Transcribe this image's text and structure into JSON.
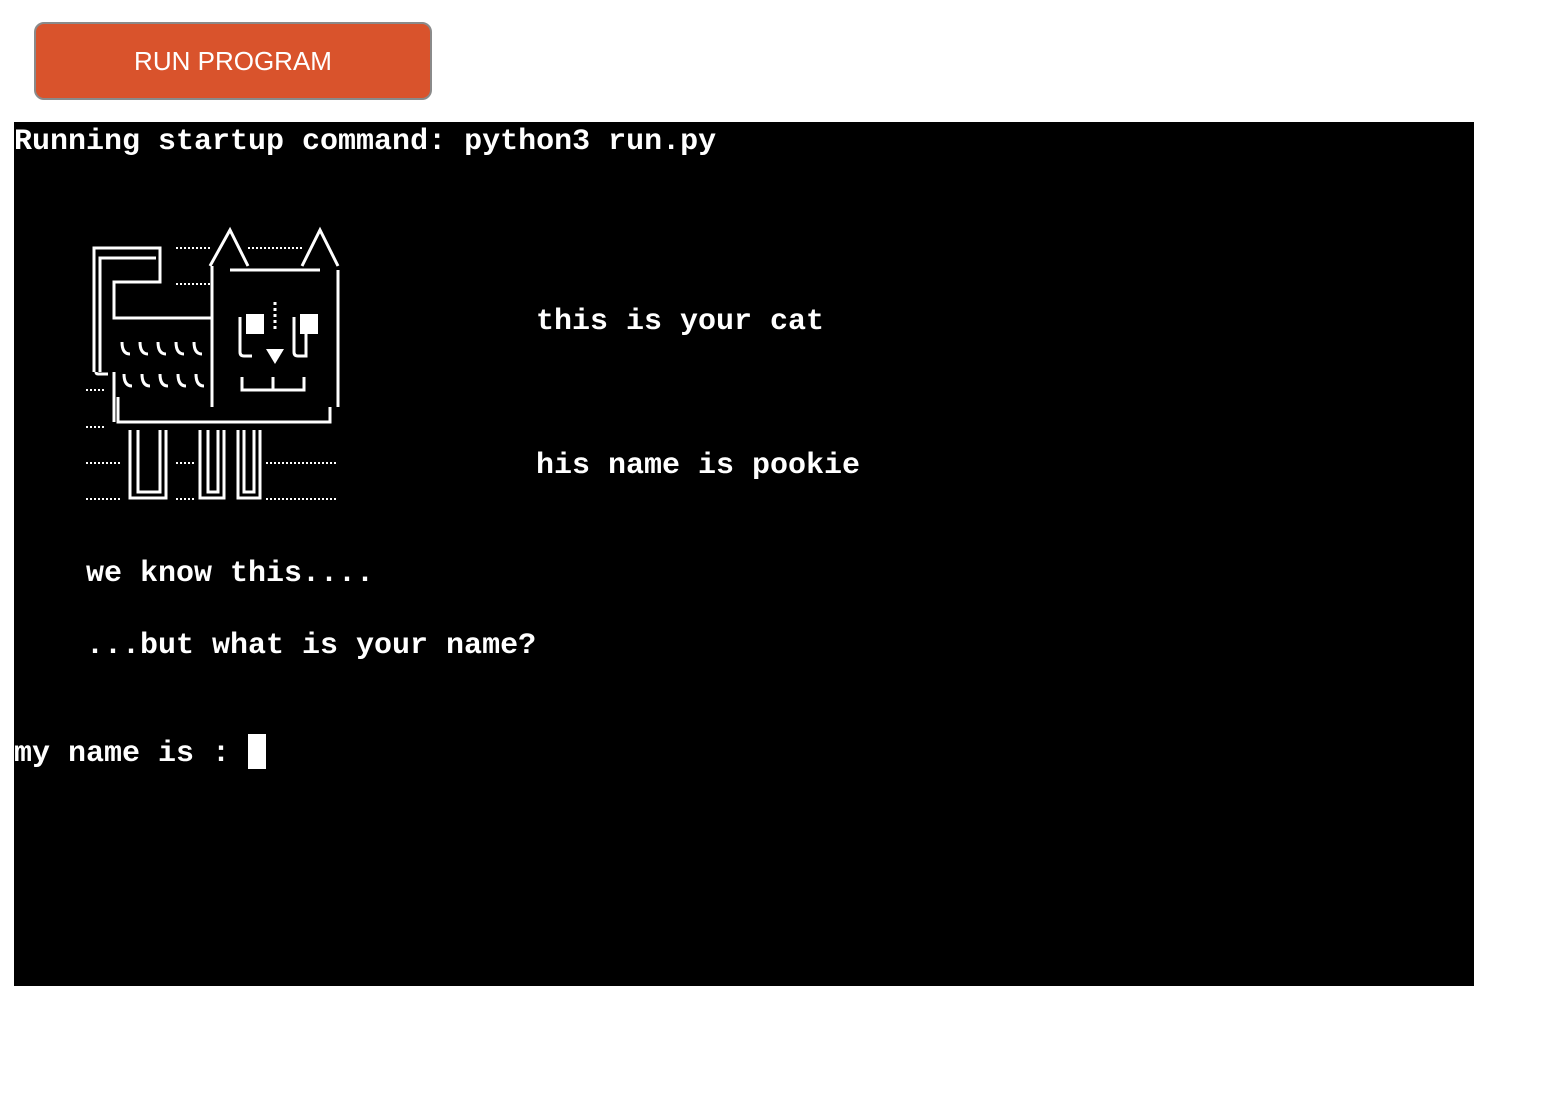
{
  "toolbar": {
    "run_label": "RUN PROGRAM",
    "accent_color": "#d9532c"
  },
  "terminal": {
    "startup_line": "Running startup command: python3 run.py",
    "cat_caption": "this is your cat",
    "cat_name_line": "his name is pookie",
    "we_know": "we know this....",
    "question": "...but what is your name?",
    "prompt": "my name is :",
    "input_value": ""
  }
}
